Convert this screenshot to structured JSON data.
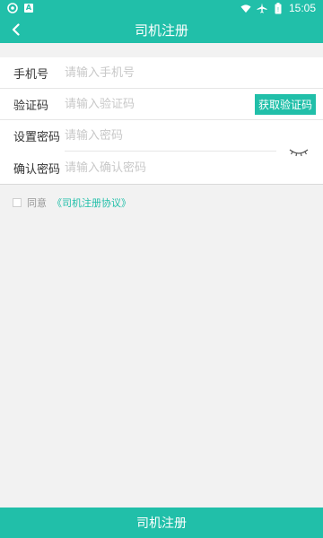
{
  "status_bar": {
    "time": "15:05",
    "icons": [
      "vpn-icon",
      "notification-a-icon",
      "wifi-icon",
      "airplane-icon",
      "battery-icon"
    ]
  },
  "nav": {
    "title": "司机注册",
    "back_icon": "back-arrow-icon"
  },
  "form": {
    "phone": {
      "label": "手机号",
      "placeholder": "请输入手机号",
      "value": ""
    },
    "code": {
      "label": "验证码",
      "placeholder": "请输入验证码",
      "value": "",
      "button": "获取验证码"
    },
    "password": {
      "label": "设置密码",
      "placeholder": "请输入密码",
      "value": ""
    },
    "confirm": {
      "label": "确认密码",
      "placeholder": "请输入确认密码",
      "value": ""
    },
    "eye_icon": "eye-closed-icon"
  },
  "agreement": {
    "checked": false,
    "text": "同意",
    "link": "《司机注册协议》"
  },
  "submit": {
    "label": "司机注册"
  },
  "colors": {
    "accent": "#21bfa9",
    "background": "#f2f2f2"
  }
}
